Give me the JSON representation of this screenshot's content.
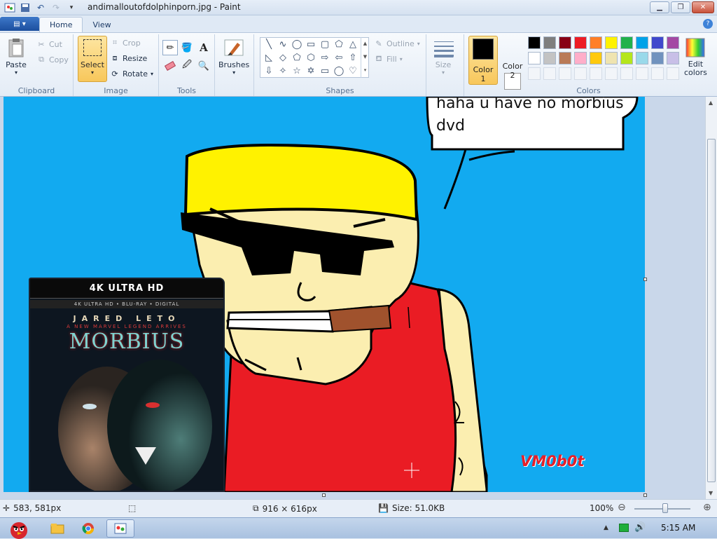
{
  "window": {
    "title": "andimalloutofdolphinporn.jpg - Paint",
    "minimize_icon": "minimize-icon",
    "maximize_icon": "restore-icon",
    "close_icon": "close-icon"
  },
  "tabs": [
    {
      "label": "Home",
      "active": true
    },
    {
      "label": "View",
      "active": false
    }
  ],
  "ribbon": {
    "clipboard": {
      "group_label": "Clipboard",
      "paste": "Paste",
      "cut": "Cut",
      "copy": "Copy"
    },
    "image": {
      "group_label": "Image",
      "select": "Select",
      "crop": "Crop",
      "resize": "Resize",
      "rotate": "Rotate"
    },
    "tools": {
      "group_label": "Tools"
    },
    "brushes": {
      "label": "Brushes"
    },
    "shapes": {
      "group_label": "Shapes",
      "outline": "Outline",
      "fill": "Fill"
    },
    "size": {
      "label": "Size"
    },
    "colors": {
      "group_label": "Colors",
      "color1_label": "Color",
      "color1_num": "1",
      "color2_label": "Color",
      "color2_num": "2",
      "edit_colors_line1": "Edit",
      "edit_colors_line2": "colors",
      "color1_value": "#000000",
      "color2_value": "#ffffff",
      "palette_row1": [
        "#000000",
        "#7f7f7f",
        "#880015",
        "#ed1c24",
        "#ff7f27",
        "#fff200",
        "#22b14c",
        "#00a2e8",
        "#3f48cc",
        "#a349a4"
      ],
      "palette_row2": [
        "#ffffff",
        "#c3c3c3",
        "#b97a57",
        "#ffaec9",
        "#ffc90e",
        "#efe4b0",
        "#b5e61d",
        "#99d9ea",
        "#7092be",
        "#c8bfe7"
      ]
    }
  },
  "canvas": {
    "bubble_text_line1": "haha u have no morbius",
    "bubble_text_line2": "dvd",
    "signature": "VM0b0t",
    "dvd_cover": {
      "format_banner": "4K ULTRA HD",
      "format_line": "4K ULTRA HD  •  BLU-RAY  •  DIGITAL",
      "actor": "JARED LETO",
      "tagline": "A NEW MARVEL LEGEND ARRIVES",
      "movie_title": "MORBIUS"
    }
  },
  "statusbar": {
    "cursor_position": "583, 581px",
    "selection_size": "",
    "image_dimensions": "916 × 616px",
    "file_size": "Size: 51.0KB",
    "zoom": "100%"
  },
  "taskbar": {
    "time": "5:15 AM"
  }
}
